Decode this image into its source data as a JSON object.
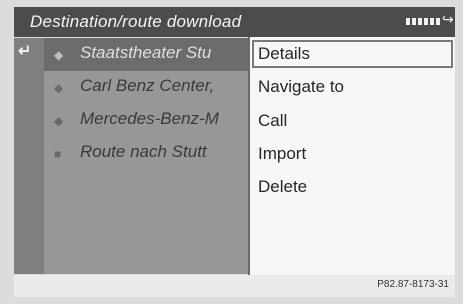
{
  "header": {
    "title": "Destination/route download"
  },
  "list": {
    "items": [
      {
        "label": "Staatstheater Stu",
        "icon": "destination-icon",
        "selected": true
      },
      {
        "label": "Carl Benz Center,",
        "icon": "destination-icon",
        "selected": false
      },
      {
        "label": "Mercedes-Benz-M",
        "icon": "destination-icon",
        "selected": false
      },
      {
        "label": "Route nach Stutt",
        "icon": "route-icon",
        "selected": false
      }
    ]
  },
  "menu": {
    "items": [
      {
        "label": "Details",
        "selected": true
      },
      {
        "label": "Navigate to",
        "selected": false
      },
      {
        "label": "Call",
        "selected": false
      },
      {
        "label": "Import",
        "selected": false
      },
      {
        "label": "Delete",
        "selected": false
      }
    ]
  },
  "footer": {
    "code": "P82.87-8173-31"
  }
}
